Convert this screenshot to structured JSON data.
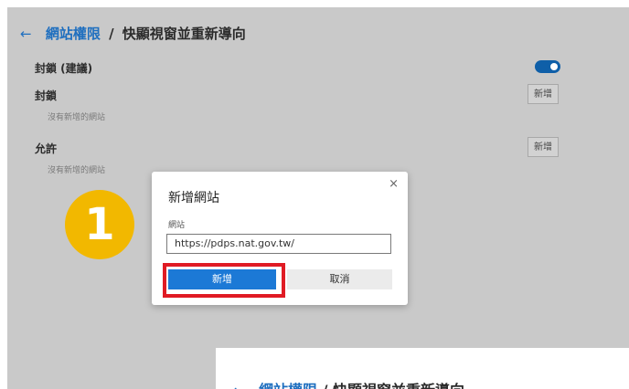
{
  "header": {
    "back_icon": "←",
    "breadcrumb_link": "網站權限",
    "breadcrumb_sep": "/",
    "page_title": "快顯視窗並重新導向"
  },
  "settings": {
    "block_recommended": {
      "label": "封鎖 (建議)",
      "toggle_on": true,
      "accent": "#0f5fa8"
    },
    "block": {
      "label": "封鎖",
      "empty_text": "沒有新增的網站",
      "add_label": "新增"
    },
    "allow": {
      "label": "允許",
      "empty_text": "沒有新增的網站",
      "add_label": "新增"
    }
  },
  "step_badge": {
    "number": "1",
    "color": "#f2b800"
  },
  "dialog": {
    "title": "新增網站",
    "close_icon": "×",
    "field_label": "網站",
    "input_value": "https://pdps.nat.gov.tw/",
    "confirm_label": "新增",
    "cancel_label": "取消",
    "highlight_color": "#e01b24"
  },
  "lower_page": {
    "back_icon": "←",
    "breadcrumb_link": "網站權限",
    "breadcrumb_sep": "/",
    "page_title": "快顯視窗並重新導向"
  }
}
